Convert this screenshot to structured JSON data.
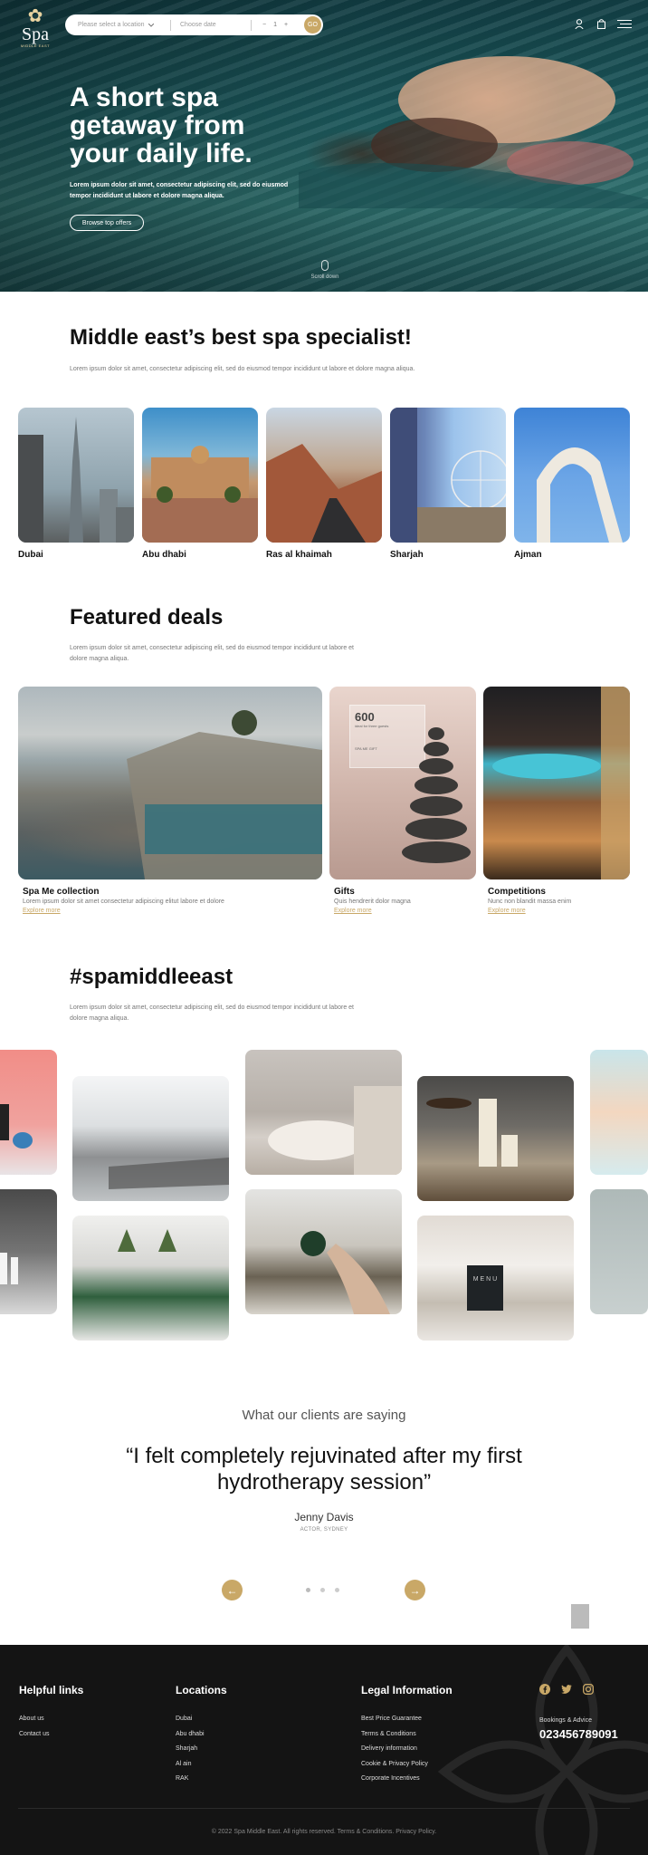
{
  "brand": {
    "logo_text": "Spa",
    "logo_sub": "MIDDLE EAST",
    "accent_color": "#c9a867"
  },
  "search": {
    "location_placeholder": "Please select a location",
    "date_placeholder": "Choose date",
    "qty_minus": "−",
    "qty_value": "1",
    "qty_plus": "+",
    "go_label": "GO"
  },
  "header_icons": [
    "user-icon",
    "bag-icon",
    "menu-icon"
  ],
  "hero": {
    "title": "A short spa getaway from your daily life.",
    "text": "Lorem ipsum dolor sit amet, consectetur adipiscing elit, sed do eiusmod tempor incididunt ut labore et dolore magna aliqua.",
    "button": "Browse top offers",
    "scroll": "Scroll down"
  },
  "specialist": {
    "title": "Middle east’s best spa specialist!",
    "text": "Lorem ipsum dolor sit amet, consectetur adipiscing elit, sed do eiusmod tempor incididunt ut labore et dolore magna aliqua.",
    "cities": [
      {
        "label": "Dubai",
        "img": "dubai"
      },
      {
        "label": "Abu dhabi",
        "img": "abudhabi"
      },
      {
        "label": "Ras al khaimah",
        "img": "ras"
      },
      {
        "label": "Sharjah",
        "img": "sharjah"
      },
      {
        "label": "Ajman",
        "img": "ajman"
      }
    ]
  },
  "deals": {
    "title": "Featured deals",
    "text": "Lorem ipsum dolor sit amet, consectetur adipiscing elit, sed do eiusmod tempor incididunt ut labore et dolore magna aliqua.",
    "items": [
      {
        "title": "Spa Me collection",
        "desc": "Lorem ipsum dolor sit amet consectetur adipiscing elitut labore et dolore",
        "link": "Explore more"
      },
      {
        "title": "Gifts",
        "desc": "Quis hendrerit dolor magna",
        "link": "Explore more",
        "voucher_value": "600",
        "voucher_line": "ideal for three guests",
        "voucher_small": "SPA ME GIFT"
      },
      {
        "title": "Competitions",
        "desc": "Nunc non blandit massa enim",
        "link": "Explore more"
      }
    ]
  },
  "gallery": {
    "title": "#spamiddleeast",
    "text": "Lorem ipsum dolor sit amet, consectetur adipiscing elit, sed do eiusmod tempor incididunt ut labore et dolore magna aliqua.",
    "menu_letters": "M E N U"
  },
  "testimonial": {
    "heading": "What our clients are saying",
    "quote": "“I felt completely rejuvinated after my first hydrotherapy session”",
    "author": "Jenny Davis",
    "role": "ACTOR, SYDNEY",
    "prev": "←",
    "next": "→"
  },
  "footer": {
    "helpful": {
      "title": "Helpful links",
      "items": [
        "About us",
        "Contact us"
      ]
    },
    "locations": {
      "title": "Locations",
      "items": [
        "Dubai",
        "Abu dhabi",
        "Sharjah",
        "Al ain",
        "RAK"
      ]
    },
    "legal": {
      "title": "Legal Information",
      "items": [
        "Best Price Guarantee",
        "Terms & Conditions",
        "Delivery information",
        "Cookie & Privacy Policy",
        "Corporate Incentives"
      ]
    },
    "social": [
      "facebook-icon",
      "twitter-icon",
      "instagram-icon"
    ],
    "bookings_label": "Bookings & Advice",
    "phone": "023456789091",
    "copyright": "© 2022 Spa Middle East. All rights reserved. Terms & Conditions. Privacy Policy."
  }
}
